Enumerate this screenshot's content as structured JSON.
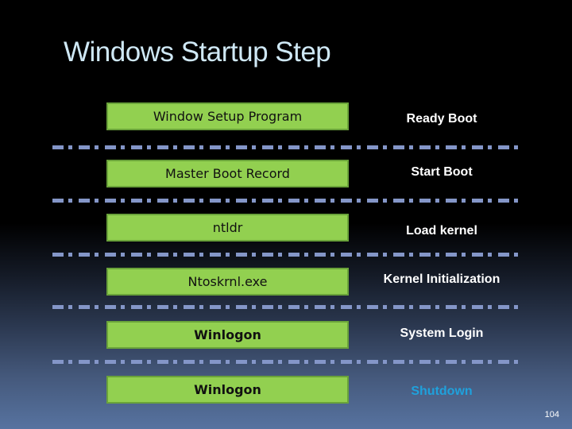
{
  "title": "Windows Startup Step",
  "steps": [
    {
      "component": "Window Setup Program",
      "phase": "Ready Boot"
    },
    {
      "component": "Master Boot Record",
      "phase": "Start Boot"
    },
    {
      "component": "ntldr",
      "phase": "Load kernel"
    },
    {
      "component": "Ntoskrnl.exe",
      "phase": "Kernel Initialization"
    },
    {
      "component": "Winlogon",
      "phase": "System Login"
    },
    {
      "component": "Winlogon",
      "phase": "Shutdown"
    }
  ],
  "colors": {
    "box_fill": "#92d050",
    "box_border": "#6aa33a",
    "separator": "#8496c8",
    "title": "#cfe8f5",
    "highlight_phase": "#1fa1dc"
  },
  "page_number": "104"
}
